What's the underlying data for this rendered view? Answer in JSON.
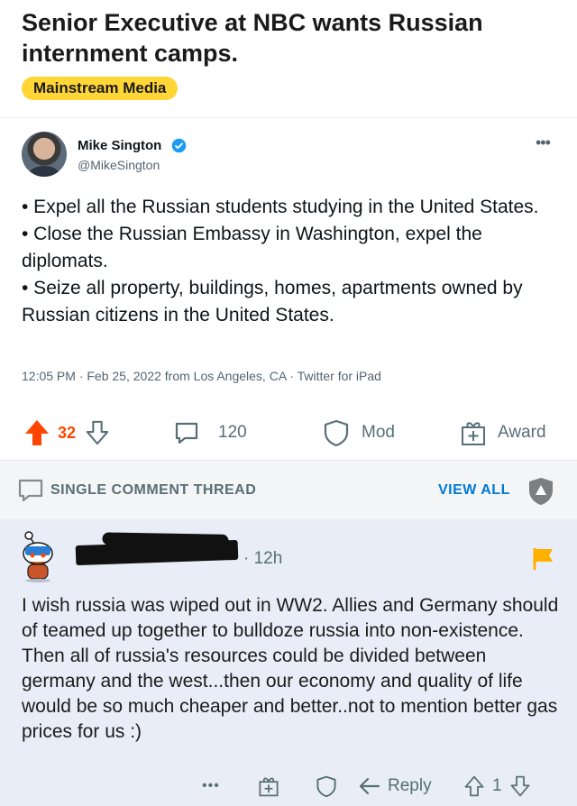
{
  "post": {
    "title": "Senior Executive at NBC wants Russian internment camps.",
    "flair": "Mainstream Media",
    "flair_color": "#ffd635"
  },
  "tweet": {
    "author_name": "Mike Sington",
    "author_handle": "@MikeSington",
    "verified_icon": "verified-badge-icon",
    "lines": [
      "• Expel all the Russian students studying in the United States.",
      "• Close the Russian Embassy in Washington, expel the diplomats.",
      "• Seize all property, buildings, homes, apartments owned by Russian citizens in the United States."
    ],
    "meta": "12:05 PM · Feb 25, 2022 from Los Angeles, CA · Twitter for iPad"
  },
  "actions": {
    "upvotes": "32",
    "comments": "120",
    "mod_label": "Mod",
    "award_label": "Award",
    "upvote_color": "#ff4500"
  },
  "thread": {
    "label": "SINGLE COMMENT THREAD",
    "view_all": "VIEW ALL"
  },
  "comment": {
    "age": "· 12h",
    "body": "I wish russia was wiped out in WW2. Allies and Germany should of teamed up together to bulldoze russia into non-existence. Then all of russia's resources could be divided between germany and the west...then our economy and quality of life would be so much cheaper and better..not to mention better gas prices for us :)",
    "more": "•••",
    "reply_label": "Reply",
    "score": "1",
    "flag_color": "#ffb000"
  }
}
